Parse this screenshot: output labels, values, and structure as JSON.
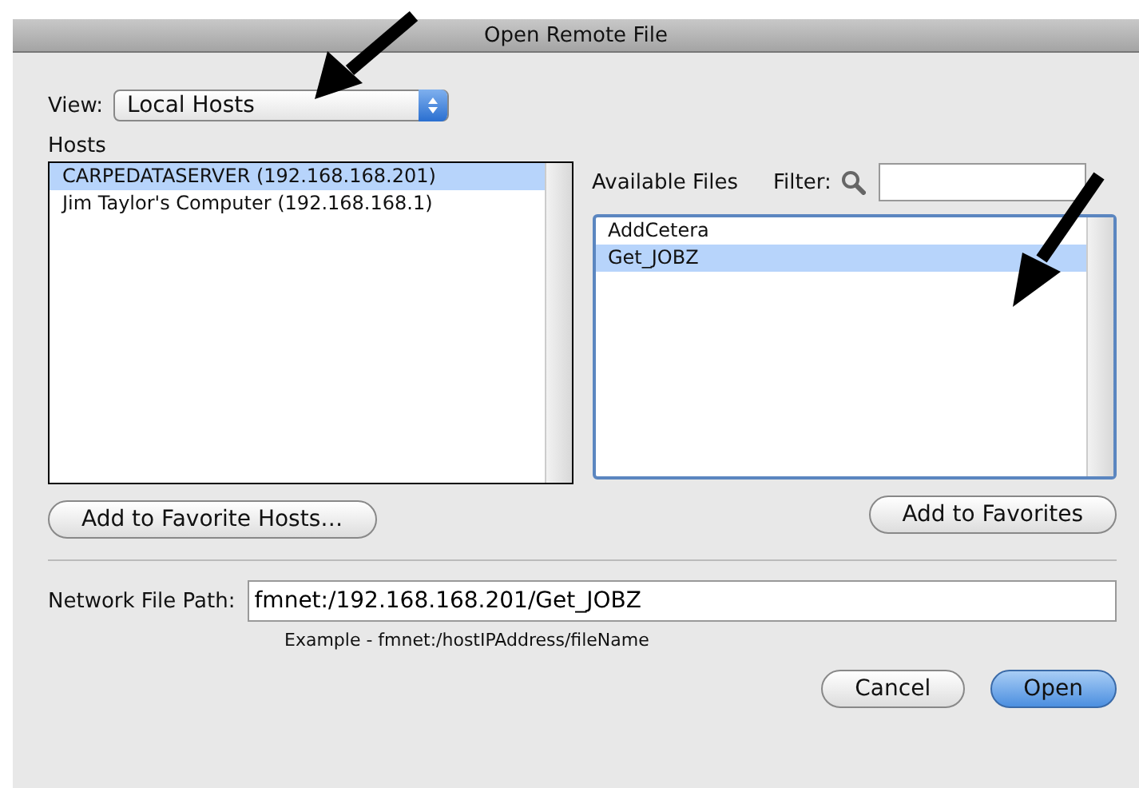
{
  "window": {
    "title": "Open Remote File"
  },
  "view": {
    "label": "View:",
    "value": "Local Hosts"
  },
  "hosts": {
    "label": "Hosts",
    "items": [
      {
        "label": "CARPEDATASERVER (192.168.168.201)",
        "selected": true
      },
      {
        "label": "Jim Taylor's Computer (192.168.168.1)",
        "selected": false
      }
    ]
  },
  "files": {
    "label": "Available Files",
    "filter_label": "Filter:",
    "items": [
      {
        "label": "AddCetera",
        "selected": false
      },
      {
        "label": "Get_JOBZ",
        "selected": true
      }
    ]
  },
  "add_favorite_hosts_button": "Add to Favorite Hosts…",
  "add_favorites_button": "Add to Favorites",
  "path": {
    "label": "Network File Path:",
    "value": "fmnet:/192.168.168.201/Get_JOBZ",
    "example": "Example - fmnet:/hostIPAddress/fileName"
  },
  "buttons": [
    {
      "label": "Cancel",
      "kind": "normal"
    },
    {
      "label": "Open",
      "kind": "default"
    }
  ]
}
